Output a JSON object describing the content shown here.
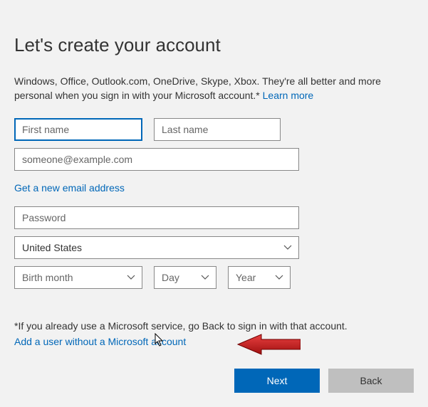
{
  "heading": "Let's create your account",
  "description": "Windows, Office, Outlook.com, OneDrive, Skype, Xbox. They're all better and more personal when you sign in with your Microsoft account.* ",
  "learn_more_link": "Learn more",
  "fields": {
    "first_name_placeholder": "First name",
    "last_name_placeholder": "Last name",
    "email_placeholder": "someone@example.com",
    "password_placeholder": "Password",
    "country_value": "United States",
    "birth_month_placeholder": "Birth month",
    "day_placeholder": "Day",
    "year_placeholder": "Year"
  },
  "new_email_link": "Get a new email address",
  "existing_note": "*If you already use a Microsoft service, go Back to sign in with that account.",
  "add_user_link": "Add a user without a Microsoft account",
  "buttons": {
    "next": "Next",
    "back": "Back"
  }
}
